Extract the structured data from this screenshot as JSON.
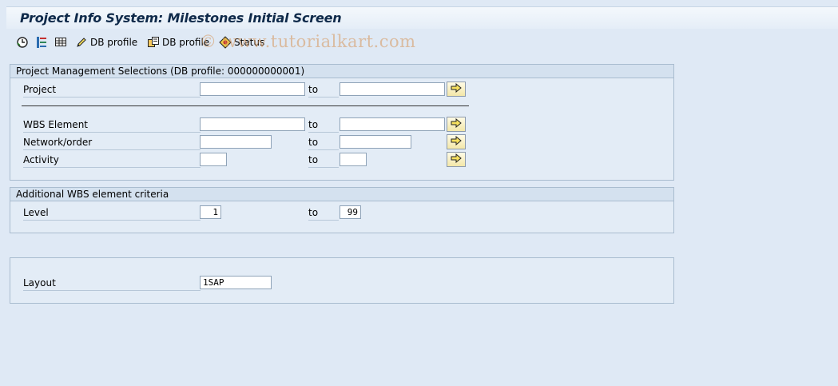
{
  "title": "Project Info System: Milestones Initial Screen",
  "toolbar": {
    "db_profile_1": "DB profile",
    "db_profile_2": "DB profile",
    "status": "Status"
  },
  "watermark": "© www.tutorialkart.com",
  "pm_group": {
    "title": "Project Management Selections (DB profile: 000000000001)",
    "project_label": "Project",
    "wbs_label": "WBS Element",
    "network_label": "Network/order",
    "activity_label": "Activity",
    "to": "to",
    "project_from": "",
    "project_to": "",
    "wbs_from": "",
    "wbs_to": "",
    "network_from": "",
    "network_to": "",
    "activity_from": "",
    "activity_to": ""
  },
  "wbs_group": {
    "title": "Additional WBS element criteria",
    "level_label": "Level",
    "to": "to",
    "level_from": "1",
    "level_to": "99"
  },
  "layout_group": {
    "layout_label": "Layout",
    "layout_value": "1SAP"
  }
}
